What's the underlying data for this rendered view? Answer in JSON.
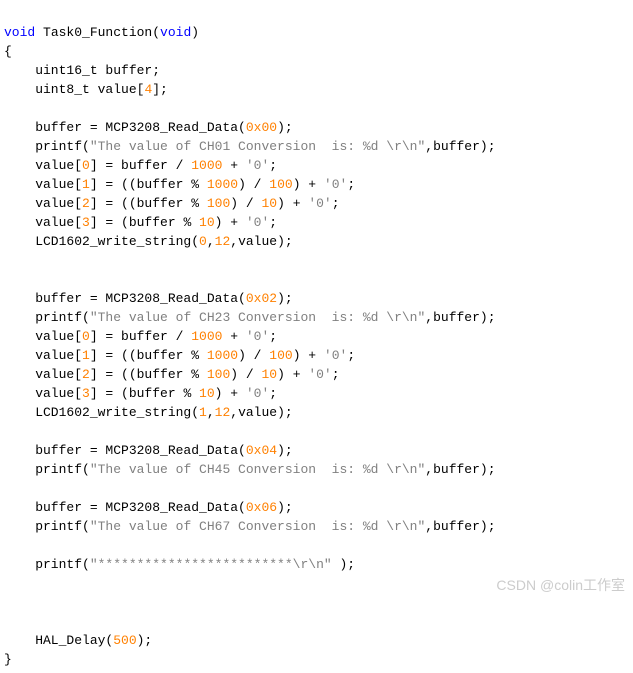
{
  "code": {
    "l1_kw": "void",
    "l1_rest": " Task0_Function(",
    "l1_kw2": "void",
    "l1_end": ")",
    "l2": "{",
    "l3_pre": "    uint16_t buffer;",
    "l4_pre": "    uint8_t value[",
    "l4_num": "4",
    "l4_end": "];",
    "l6_pre": "    buffer = MCP3208_Read_Data(",
    "l6_num": "0x00",
    "l6_end": ");",
    "l7_pre": "    printf(",
    "l7_str": "\"The value of CH01 Conversion  is: %d \\r\\n\"",
    "l7_end": ",buffer);",
    "l8_pre": "    value[",
    "l8_n1": "0",
    "l8_mid": "] = buffer / ",
    "l8_n2": "1000",
    "l8_mid2": " + ",
    "l8_char": "'0'",
    "l8_end": ";",
    "l9_pre": "    value[",
    "l9_n1": "1",
    "l9_mid": "] = ((buffer % ",
    "l9_n2": "1000",
    "l9_mid2": ") / ",
    "l9_n3": "100",
    "l9_mid3": ") + ",
    "l9_char": "'0'",
    "l9_end": ";",
    "l10_pre": "    value[",
    "l10_n1": "2",
    "l10_mid": "] = ((buffer % ",
    "l10_n2": "100",
    "l10_mid2": ") / ",
    "l10_n3": "10",
    "l10_mid3": ") + ",
    "l10_char": "'0'",
    "l10_end": ";",
    "l11_pre": "    value[",
    "l11_n1": "3",
    "l11_mid": "] = (buffer % ",
    "l11_n2": "10",
    "l11_mid2": ") + ",
    "l11_char": "'0'",
    "l11_end": ";",
    "l12_pre": "    LCD1602_write_string(",
    "l12_n1": "0",
    "l12_mid": ",",
    "l12_n2": "12",
    "l12_end": ",value);",
    "l15_pre": "    buffer = MCP3208_Read_Data(",
    "l15_num": "0x02",
    "l15_end": ");",
    "l16_pre": "    printf(",
    "l16_str": "\"The value of CH23 Conversion  is: %d \\r\\n\"",
    "l16_end": ",buffer);",
    "l17_pre": "    value[",
    "l17_n1": "0",
    "l17_mid": "] = buffer / ",
    "l17_n2": "1000",
    "l17_mid2": " + ",
    "l17_char": "'0'",
    "l17_end": ";",
    "l18_pre": "    value[",
    "l18_n1": "1",
    "l18_mid": "] = ((buffer % ",
    "l18_n2": "1000",
    "l18_mid2": ") / ",
    "l18_n3": "100",
    "l18_mid3": ") + ",
    "l18_char": "'0'",
    "l18_end": ";",
    "l19_pre": "    value[",
    "l19_n1": "2",
    "l19_mid": "] = ((buffer % ",
    "l19_n2": "100",
    "l19_mid2": ") / ",
    "l19_n3": "10",
    "l19_mid3": ") + ",
    "l19_char": "'0'",
    "l19_end": ";",
    "l20_pre": "    value[",
    "l20_n1": "3",
    "l20_mid": "] = (buffer % ",
    "l20_n2": "10",
    "l20_mid2": ") + ",
    "l20_char": "'0'",
    "l20_end": ";",
    "l21_pre": "    LCD1602_write_string(",
    "l21_n1": "1",
    "l21_mid": ",",
    "l21_n2": "12",
    "l21_end": ",value);",
    "l23_pre": "    buffer = MCP3208_Read_Data(",
    "l23_num": "0x04",
    "l23_end": ");",
    "l24_pre": "    printf(",
    "l24_str": "\"The value of CH45 Conversion  is: %d \\r\\n\"",
    "l24_end": ",buffer);",
    "l26_pre": "    buffer = MCP3208_Read_Data(",
    "l26_num": "0x06",
    "l26_end": ");",
    "l27_pre": "    printf(",
    "l27_str": "\"The value of CH67 Conversion  is: %d \\r\\n\"",
    "l27_end": ",buffer);",
    "l29_pre": "    printf(",
    "l29_str": "\"*************************\\r\\n\"",
    "l29_end": " );",
    "l32_pre": "    HAL_Delay(",
    "l32_num": "500",
    "l32_end": ");",
    "l33": "}"
  },
  "watermark": "CSDN @colin工作室"
}
